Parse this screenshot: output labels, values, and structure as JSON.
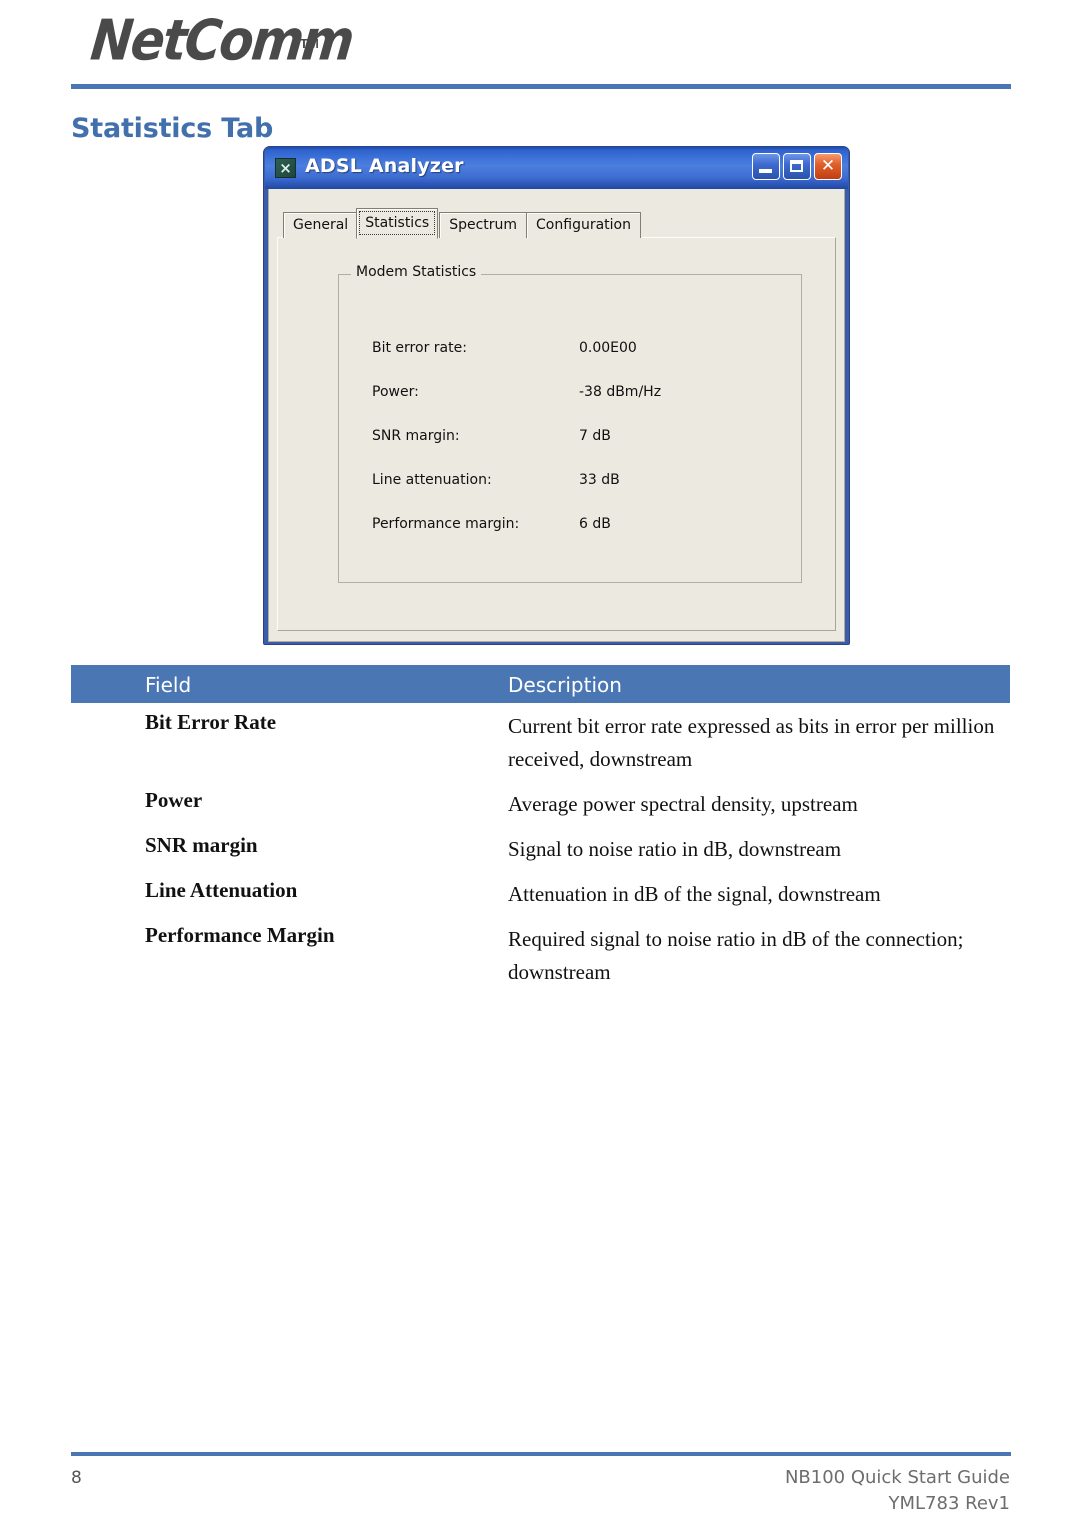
{
  "brand": {
    "logo_text": "NetComm",
    "trademark": "TM",
    "accent_color": "#4a77b4"
  },
  "page": {
    "title": "Statistics Tab"
  },
  "dialog": {
    "title": "ADSL Analyzer",
    "icon": "adsl-analyzer-icon",
    "window_buttons": [
      {
        "name": "minimize",
        "glyph": "_"
      },
      {
        "name": "maximize",
        "glyph": "□"
      },
      {
        "name": "close",
        "glyph": "✕"
      }
    ],
    "tabs": [
      {
        "label": "General",
        "selected": false
      },
      {
        "label": "Statistics",
        "selected": true
      },
      {
        "label": "Spectrum",
        "selected": false
      },
      {
        "label": "Configuration",
        "selected": false
      }
    ],
    "group": {
      "legend": "Modem Statistics",
      "rows": [
        {
          "label": "Bit error rate:",
          "value": "0.00E00"
        },
        {
          "label": "Power:",
          "value": "-38 dBm/Hz"
        },
        {
          "label": "SNR margin:",
          "value": "7 dB"
        },
        {
          "label": "Line attenuation:",
          "value": "33 dB"
        },
        {
          "label": "Performance  margin:",
          "value": "6 dB"
        }
      ]
    }
  },
  "table": {
    "headers": {
      "field": "Field",
      "description": "Description"
    },
    "header_bg": "#4a77b4",
    "rows": [
      {
        "field": "Bit Error Rate",
        "description": "Current bit error rate expressed as bits in error per million received, downstream"
      },
      {
        "field": "Power",
        "description": "Average power spectral density, upstream"
      },
      {
        "field": "SNR margin",
        "description": "Signal to noise ratio in dB, downstream"
      },
      {
        "field": "Line Attenuation",
        "description": "Attenuation in dB of the signal, downstream"
      },
      {
        "field": "Performance Margin",
        "description": "Required signal to noise ratio in dB of the connection; downstream"
      }
    ]
  },
  "footer": {
    "page_number": "8",
    "guide": "NB100 Quick Start Guide",
    "revision": "YML783 Rev1"
  }
}
